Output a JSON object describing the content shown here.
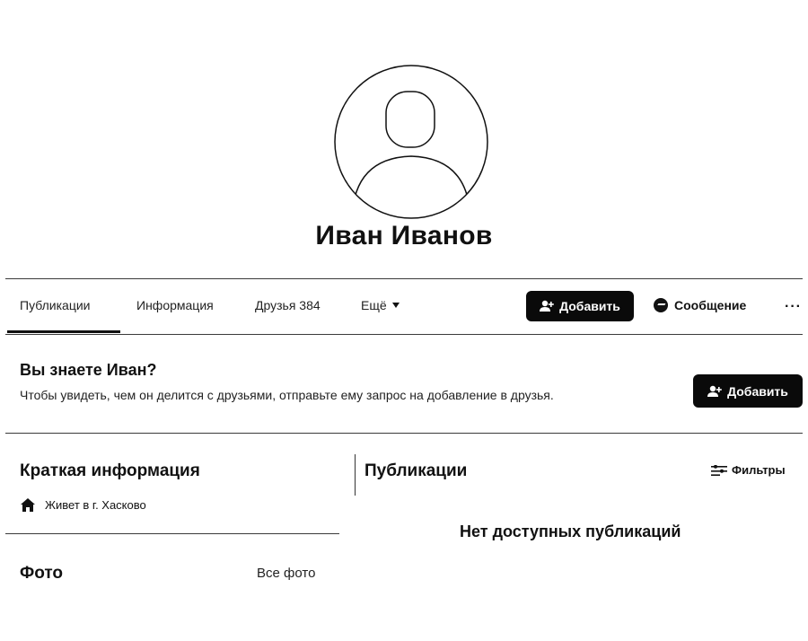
{
  "profile": {
    "name": "Иван Иванов"
  },
  "tabs": [
    {
      "label": "Публикации",
      "active": true
    },
    {
      "label": "Информация"
    },
    {
      "label": "Друзья 384"
    },
    {
      "label": "Ещё"
    }
  ],
  "actions": {
    "add_label": "Добавить",
    "message_label": "Сообщение",
    "more_label": "···"
  },
  "know_box": {
    "title": "Вы знаете Иван?",
    "text": "Чтобы увидеть, чем он делится с друзьями, отправьте ему запрос на добавление в друзья.",
    "add_label": "Добавить"
  },
  "intro": {
    "title": "Краткая информация",
    "lives_in": "Живет в г. Хасково"
  },
  "posts": {
    "title": "Публикации",
    "filters_label": "Фильтры",
    "empty_text": "Нет доступных публикаций"
  },
  "photos": {
    "title": "Фото",
    "all_label": "Все фото"
  },
  "colors": {
    "accent": "#0a0a0a",
    "background": "#ffffff"
  },
  "icons": [
    "default-avatar-icon",
    "add-friend-icon",
    "messenger-icon",
    "home-icon",
    "filters-icon",
    "chevron-down-icon"
  ]
}
